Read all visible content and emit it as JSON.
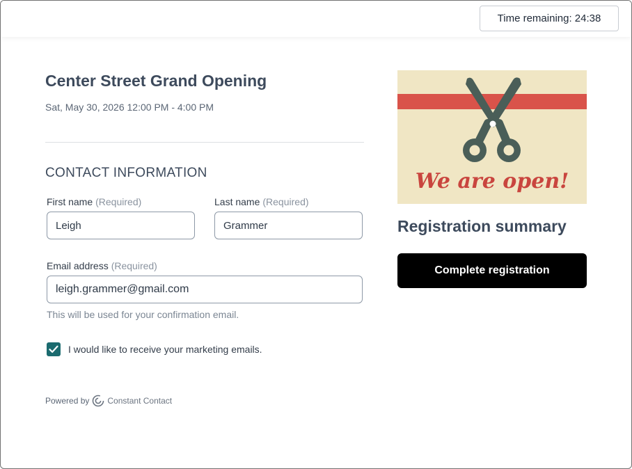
{
  "header": {
    "timer_text": "Time remaining: 24:38"
  },
  "event": {
    "title": "Center Street Grand Opening",
    "date": "Sat, May 30, 2026 12:00 PM - 4:00 PM"
  },
  "contact": {
    "section_title": "CONTACT INFORMATION",
    "first_name": {
      "label": "First name",
      "required": "(Required)",
      "value": "Leigh"
    },
    "last_name": {
      "label": "Last name",
      "required": "(Required)",
      "value": "Grammer"
    },
    "email": {
      "label": "Email address",
      "required": "(Required)",
      "value": "leigh.grammer@gmail.com",
      "hint": "This will be used for your confirmation email."
    },
    "marketing": {
      "label": "I would like to receive your marketing emails.",
      "checked": true
    }
  },
  "footer": {
    "powered_by": "Powered by",
    "brand": "Constant Contact"
  },
  "sidebar": {
    "banner_text": "We are open!",
    "summary_title": "Registration summary",
    "complete_button": "Complete registration"
  },
  "icons": {
    "banner": "scissors-icon",
    "checkbox": "checkmark-icon",
    "brand_logo": "constant-contact-logo-icon"
  },
  "colors": {
    "accent_teal": "#1b6b6f",
    "title_text": "#3d4a5c",
    "banner_bg": "#f0e6c4",
    "ribbon_red": "#d9534a",
    "scissors": "#4a5e58",
    "button_bg": "#000000"
  }
}
